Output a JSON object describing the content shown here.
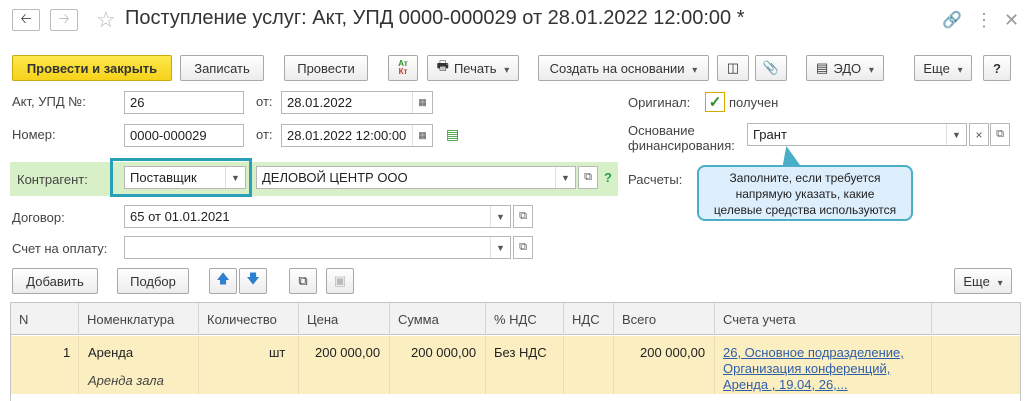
{
  "window": {
    "title": "Поступление услуг: Акт, УПД 0000-000029 от 28.01.2022 12:00:00 *"
  },
  "icons": {
    "back": "arrow-left-icon",
    "forward": "arrow-right-icon",
    "favorite": "star-icon",
    "link": "link-icon",
    "more": "more-vertical-icon",
    "close": "close-icon"
  },
  "toolbar": {
    "post_close": "Провести и закрыть",
    "save": "Записать",
    "post": "Провести",
    "dtkt": "Дт Кт",
    "print": "Печать",
    "create_based": "Создать на основании",
    "edo": "ЭДО",
    "more": "Еще",
    "help": "?"
  },
  "form": {
    "act_label": "Акт, УПД №:",
    "act_value": "26",
    "act_date_label": "от:",
    "act_date": "28.01.2022",
    "number_label": "Номер:",
    "number_value": "0000-000029",
    "number_date_label": "от:",
    "number_date": "28.01.2022 12:00:00",
    "counterparty_label": "Контрагент:",
    "counterparty_role": "Поставщик",
    "counterparty_name": "ДЕЛОВОЙ ЦЕНТР ООО",
    "counterparty_help": "?",
    "contract_label": "Договор:",
    "contract_value": "65 от 01.01.2021",
    "invoice_label": "Счет на оплату:",
    "invoice_value": "",
    "original_label": "Оригинал:",
    "original_checked_label": "получен",
    "funding_label_1": "Основание",
    "funding_label_2": "финансирования:",
    "funding_value": "Грант",
    "settlements_label": "Расчеты:"
  },
  "tooltip": {
    "line1": "Заполните, если требуется",
    "line2": "напрямую указать, какие",
    "line3": "целевые средства используются"
  },
  "table_toolbar": {
    "add": "Добавить",
    "pick": "Подбор",
    "more": "Еще"
  },
  "table": {
    "headers": [
      "N",
      "Номенклатура",
      "Количество",
      "Цена",
      "Сумма",
      "% НДС",
      "НДС",
      "Всего",
      "Счета учета"
    ],
    "row": {
      "n": "1",
      "item": "Аренда",
      "item_sub": "Аренда зала",
      "unit": "шт",
      "price": "200 000,00",
      "sum": "200 000,00",
      "vat_rate": "Без НДС",
      "vat": "",
      "total": "200 000,00",
      "accounts_1": "26, Основное подразделение,",
      "accounts_2": "Организация конференций,",
      "accounts_3": "Аренда , 19.04, 26,..."
    }
  },
  "colors": {
    "primary_button": "#f6d21a",
    "highlight_border": "#2a9fb8",
    "counterparty_band": "#d7f0c8",
    "row_selected": "#fbefc2",
    "tooltip_bg": "#ddeefc",
    "link": "#2f5ea8"
  }
}
